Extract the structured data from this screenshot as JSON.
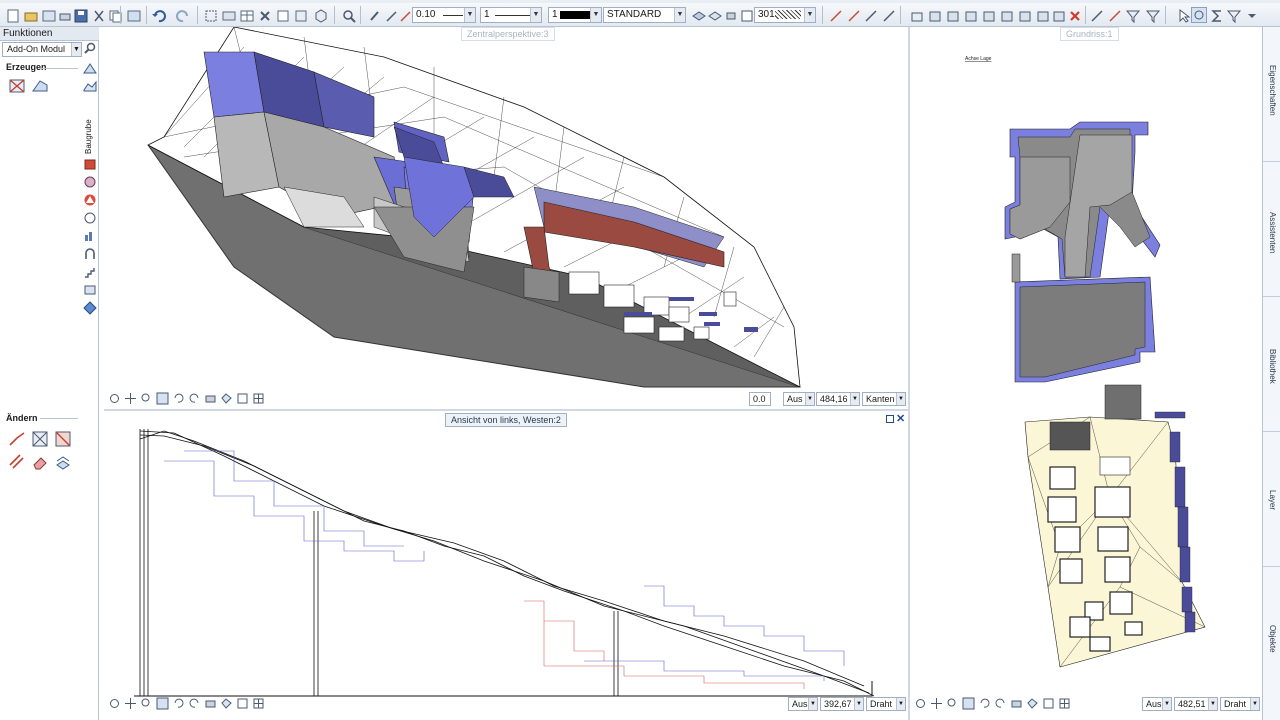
{
  "toolbar": {
    "pen_value": "0.10",
    "line_value": "1",
    "color_value": "1",
    "layer_value": "STANDARD",
    "pattern_value": "301"
  },
  "left_panel": {
    "title": "Funktionen",
    "module_select": "Add-On Modul",
    "section_create": "Erzeugen",
    "section_modify": "Ändern",
    "vertical_label": "Baugrube"
  },
  "viewport_3d": {
    "title": "Zentralperspektive:3",
    "value_a": "0.0",
    "mode_a": "Aus",
    "scale": "484,16",
    "render_mode": "Kanten"
  },
  "viewport_side": {
    "title": "Ansicht von links, Westen:2",
    "mode_a": "Aus",
    "scale": "392,67",
    "render_mode": "Draht"
  },
  "viewport_plan": {
    "title": "Grundriss:1",
    "small_caption": "Achse Lage",
    "mode_a": "Aus",
    "scale": "482,51",
    "render_mode": "Draht"
  },
  "right_dock": {
    "tabs": [
      "Eigenschaften",
      "Assistenten",
      "Bibliothek",
      "Layer",
      "Objekte"
    ]
  },
  "colors": {
    "building_blue": "#7b7fe0",
    "building_dark": "#4a4c9a",
    "terrain_gray": "#6f6f6f",
    "floor_gray": "#a8a8a8",
    "brick_red": "#9b4a42",
    "plan_fill": "#fbf6d6",
    "toolbar_bg": "#e3e9f1"
  }
}
